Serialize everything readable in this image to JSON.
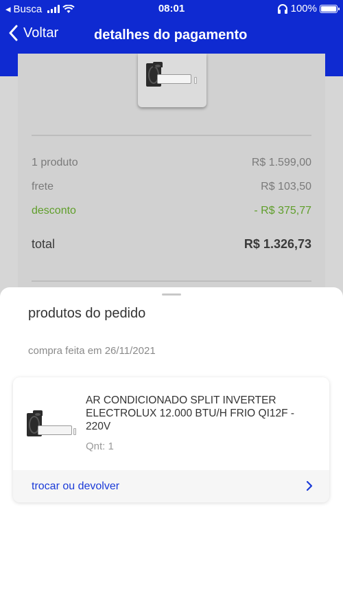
{
  "status_bar": {
    "carrier": "Busca",
    "time": "08:01",
    "battery": "100%"
  },
  "header": {
    "back_label": "Voltar",
    "title": "detalhes do pagamento"
  },
  "summary": {
    "products_label": "1 produto",
    "products_value": "R$ 1.599,00",
    "shipping_label": "frete",
    "shipping_value": "R$ 103,50",
    "discount_label": "desconto",
    "discount_value": "- R$ 375,77",
    "total_label": "total",
    "total_value": "R$ 1.326,73"
  },
  "sheet": {
    "title": "produtos do pedido",
    "purchase_date": "compra feita em 26/11/2021",
    "product": {
      "name": "AR CONDICIONADO SPLIT INVERTER ELECTROLUX 12.000 BTU/H FRIO QI12F - 220V",
      "quantity": "Qnt: 1"
    },
    "action_label": "trocar ou devolver"
  },
  "colors": {
    "brand_blue": "#0f2ad1",
    "discount_green": "#5f9e2a",
    "link_blue": "#1a3ad8"
  }
}
